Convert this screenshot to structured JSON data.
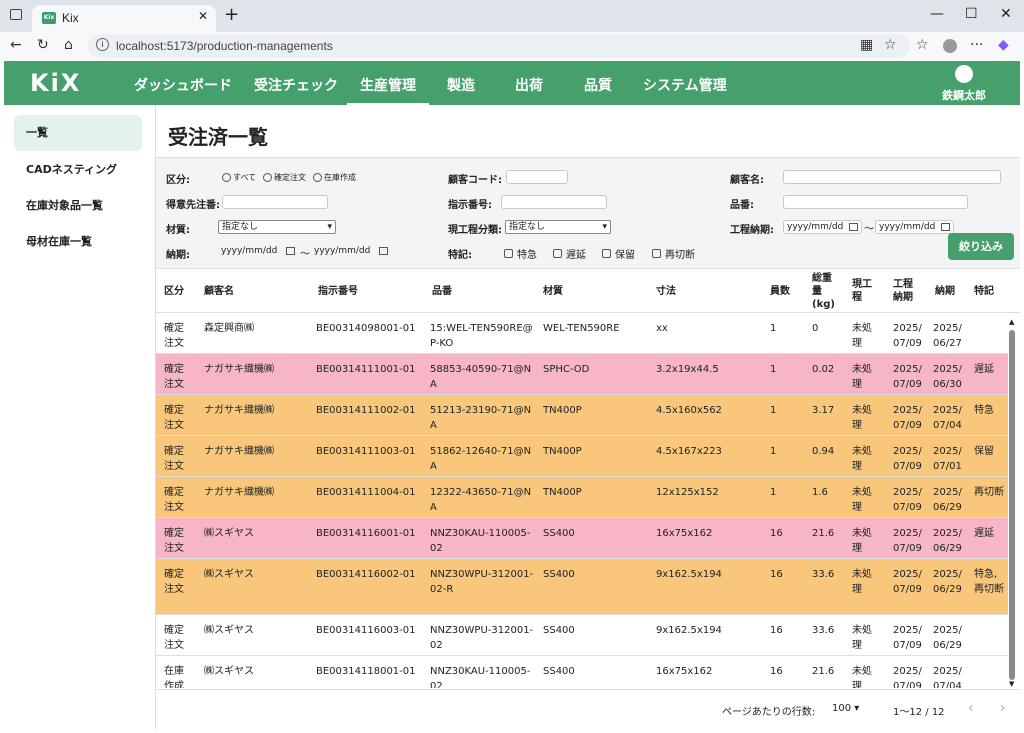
{
  "browser": {
    "tab_title": "Kix",
    "favicon": "Kix",
    "url": "localhost:5173/production-managements"
  },
  "app": {
    "logo": "KiX",
    "menu": [
      "ダッシュボード",
      "受注チェック",
      "生産管理",
      "製造",
      "出荷",
      "品質",
      "システム管理"
    ],
    "user": "鉄鋼太郎"
  },
  "sidebar": [
    "一覧",
    "CADネスティング",
    "在庫対象品一覧",
    "母材在庫一覧"
  ],
  "page_title": "受注済一覧",
  "filters": {
    "kubun_label": "区分:",
    "radio_all": "すべて",
    "radio_confirmed": "確定注文",
    "radio_stock": "在庫作成",
    "customer_code_label": "顧客コード:",
    "customer_name_label": "顧客名:",
    "preferred_customer_label": "得意先注番:",
    "order_no_label": "指示番号:",
    "part_no_label": "品番:",
    "material_label": "材質:",
    "material_value": "指定なし",
    "process_label": "現工程分類:",
    "process_value": "指定なし",
    "process_due_label": "工程納期:",
    "due_label": "納期:",
    "date_placeholder": "yyyy/mm/dd",
    "tilde": "〜",
    "special_label": "特記:",
    "chk_urgent": "特急",
    "chk_delay": "遅延",
    "chk_hold": "保留",
    "chk_recut": "再切断",
    "filter_button": "絞り込み"
  },
  "table": {
    "headers": [
      "区分",
      "顧客名",
      "指示番号",
      "品番",
      "材質",
      "寸法",
      "員数",
      "総重量(kg)",
      "現工程",
      "工程納期",
      "納期",
      "特記"
    ],
    "colors": {
      "pink": "#f6b6c6",
      "orange": "#f8c77c",
      "white": "#ffffff"
    },
    "rows": [
      {
        "c": "white",
        "kubun": "確定注文",
        "customer": "森定興商㈱",
        "order": "BE00314098001-01",
        "part": "15:WEL-TEN590RE@P-KO",
        "mat": "WEL-TEN590RE",
        "size": "xx",
        "qty": "1",
        "wt": "0",
        "proc": "未処理",
        "pdue": "2025/07/09",
        "due": "2025/06/27",
        "note": ""
      },
      {
        "c": "pink",
        "kubun": "確定注文",
        "customer": "ナガサキ織機㈱",
        "order": "BE00314111001-01",
        "part": "58853-40590-71@NA",
        "mat": "SPHC-OD",
        "size": "3.2x19x44.5",
        "qty": "1",
        "wt": "0.02",
        "proc": "未処理",
        "pdue": "2025/07/09",
        "due": "2025/06/30",
        "note": "遅延"
      },
      {
        "c": "orange",
        "kubun": "確定注文",
        "customer": "ナガサキ織機㈱",
        "order": "BE00314111002-01",
        "part": "51213-23190-71@NA",
        "mat": "TN400P",
        "size": "4.5x160x562",
        "qty": "1",
        "wt": "3.17",
        "proc": "未処理",
        "pdue": "2025/07/09",
        "due": "2025/07/04",
        "note": "特急"
      },
      {
        "c": "orange",
        "kubun": "確定注文",
        "customer": "ナガサキ織機㈱",
        "order": "BE00314111003-01",
        "part": "51862-12640-71@NA",
        "mat": "TN400P",
        "size": "4.5x167x223",
        "qty": "1",
        "wt": "0.94",
        "proc": "未処理",
        "pdue": "2025/07/09",
        "due": "2025/07/01",
        "note": "保留"
      },
      {
        "c": "orange",
        "kubun": "確定注文",
        "customer": "ナガサキ織機㈱",
        "order": "BE00314111004-01",
        "part": "12322-43650-71@NA",
        "mat": "TN400P",
        "size": "12x125x152",
        "qty": "1",
        "wt": "1.6",
        "proc": "未処理",
        "pdue": "2025/07/09",
        "due": "2025/06/29",
        "note": "再切断"
      },
      {
        "c": "pink",
        "kubun": "確定注文",
        "customer": "㈱スギヤス",
        "order": "BE00314116001-01",
        "part": "NNZ30KAU-110005-02",
        "mat": "SS400",
        "size": "16x75x162",
        "qty": "16",
        "wt": "21.6",
        "proc": "未処理",
        "pdue": "2025/07/09",
        "due": "2025/06/29",
        "note": "遅延"
      },
      {
        "c": "orange",
        "kubun": "確定注文",
        "customer": "㈱スギヤス",
        "order": "BE00314116002-01",
        "part": "NNZ30WPU-312001-02-R",
        "mat": "SS400",
        "size": "9x162.5x194",
        "qty": "16",
        "wt": "33.6",
        "proc": "未処理",
        "pdue": "2025/07/09",
        "due": "2025/06/29",
        "note": "特急,再切断"
      },
      {
        "c": "white",
        "kubun": "確定注文",
        "customer": "㈱スギヤス",
        "order": "BE00314116003-01",
        "part": "NNZ30WPU-312001-02",
        "mat": "SS400",
        "size": "9x162.5x194",
        "qty": "16",
        "wt": "33.6",
        "proc": "未処理",
        "pdue": "2025/07/09",
        "due": "2025/06/29",
        "note": ""
      },
      {
        "c": "white",
        "kubun": "在庫作成",
        "customer": "㈱スギヤス",
        "order": "BE00314118001-01",
        "part": "NNZ30KAU-110005-02",
        "mat": "SS400",
        "size": "16x75x162",
        "qty": "16",
        "wt": "21.6",
        "proc": "未処理",
        "pdue": "2025/07/09",
        "due": "2025/07/04",
        "note": ""
      }
    ]
  },
  "footer": {
    "rows_per_page_label": "ページあたりの行数:",
    "rows_per_page": "100",
    "range": "1〜12 / 12"
  }
}
